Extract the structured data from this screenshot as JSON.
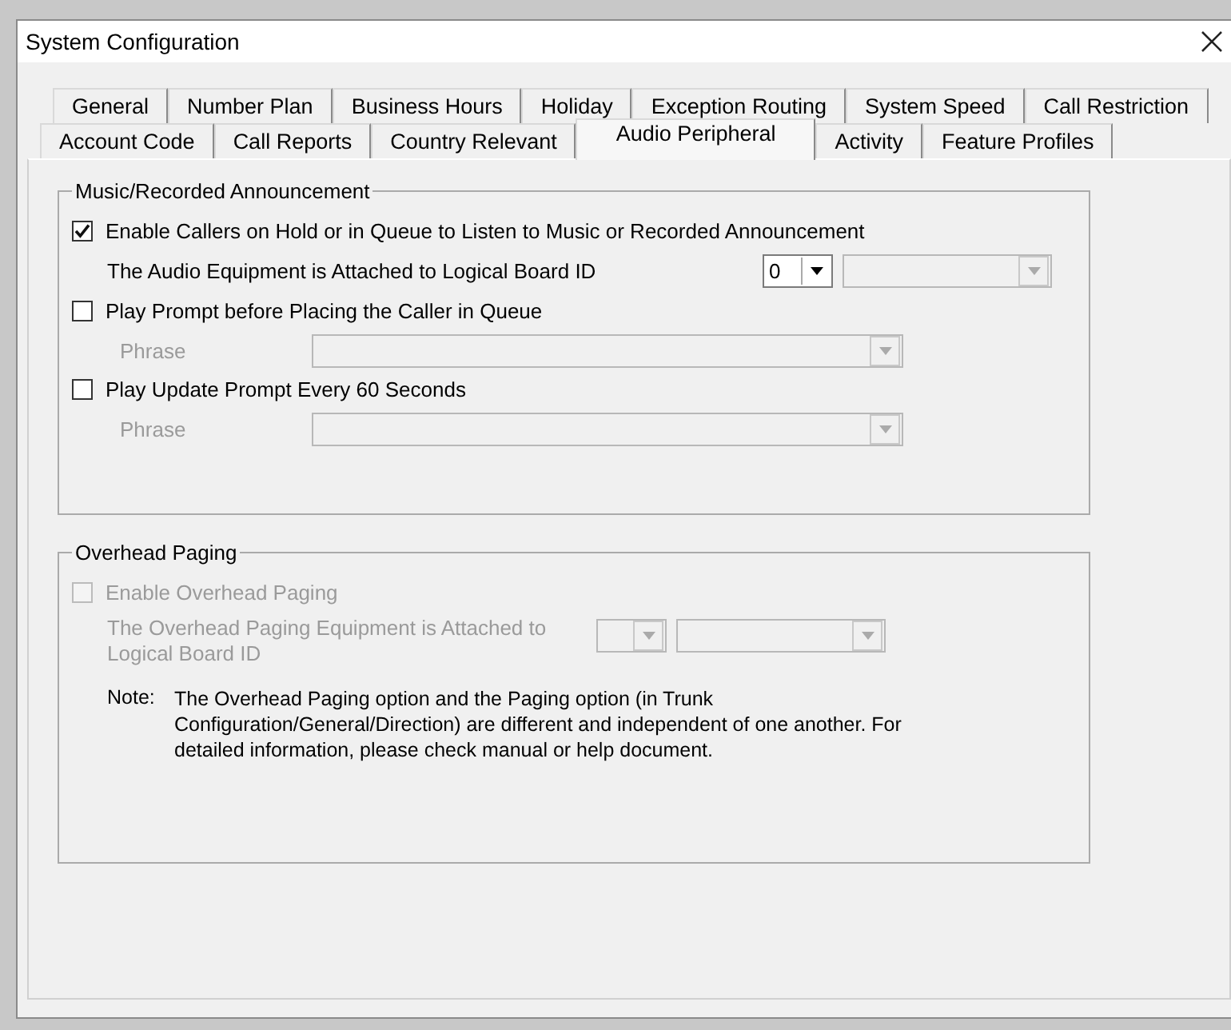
{
  "window": {
    "title": "System Configuration"
  },
  "tab_rows": [
    [
      {
        "label": "General",
        "selected": false
      },
      {
        "label": "Number Plan",
        "selected": false
      },
      {
        "label": "Business Hours",
        "selected": false
      },
      {
        "label": "Holiday",
        "selected": false
      },
      {
        "label": "Exception Routing",
        "selected": false
      },
      {
        "label": "System Speed",
        "selected": false
      },
      {
        "label": "Call Restriction",
        "selected": false
      }
    ],
    [
      {
        "label": "Account Code",
        "selected": false
      },
      {
        "label": "Call Reports",
        "selected": false
      },
      {
        "label": "Country Relevant",
        "selected": false
      },
      {
        "label": "Audio Peripheral",
        "selected": true
      },
      {
        "label": "Activity",
        "selected": false
      },
      {
        "label": "Feature Profiles",
        "selected": false
      }
    ]
  ],
  "music": {
    "title": "Music/Recorded Announcement",
    "enable": {
      "label": "Enable Callers on Hold or in Queue to Listen to Music or Recorded Announcement",
      "checked": true
    },
    "board": {
      "label": "The Audio Equipment is Attached to Logical Board ID",
      "value": "0",
      "disabled": false
    },
    "prompts": [
      {
        "label": "Play Prompt before Placing the Caller in Queue",
        "checked": false,
        "phrase_label": "Phrase"
      },
      {
        "label": "Play Update Prompt Every 60 Seconds",
        "checked": false,
        "phrase_label": "Phrase"
      }
    ]
  },
  "paging": {
    "title": "Overhead Paging",
    "enable": {
      "label": "Enable Overhead Paging",
      "checked": false,
      "disabled": true
    },
    "board": {
      "label": "The Overhead Paging Equipment is Attached to Logical Board ID",
      "disabled": true
    },
    "note_label": "Note:",
    "note": "The Overhead Paging option and the Paging option (in Trunk Configuration/General/Direction) are different and independent of one another. For detailed information, please check manual or help document."
  }
}
